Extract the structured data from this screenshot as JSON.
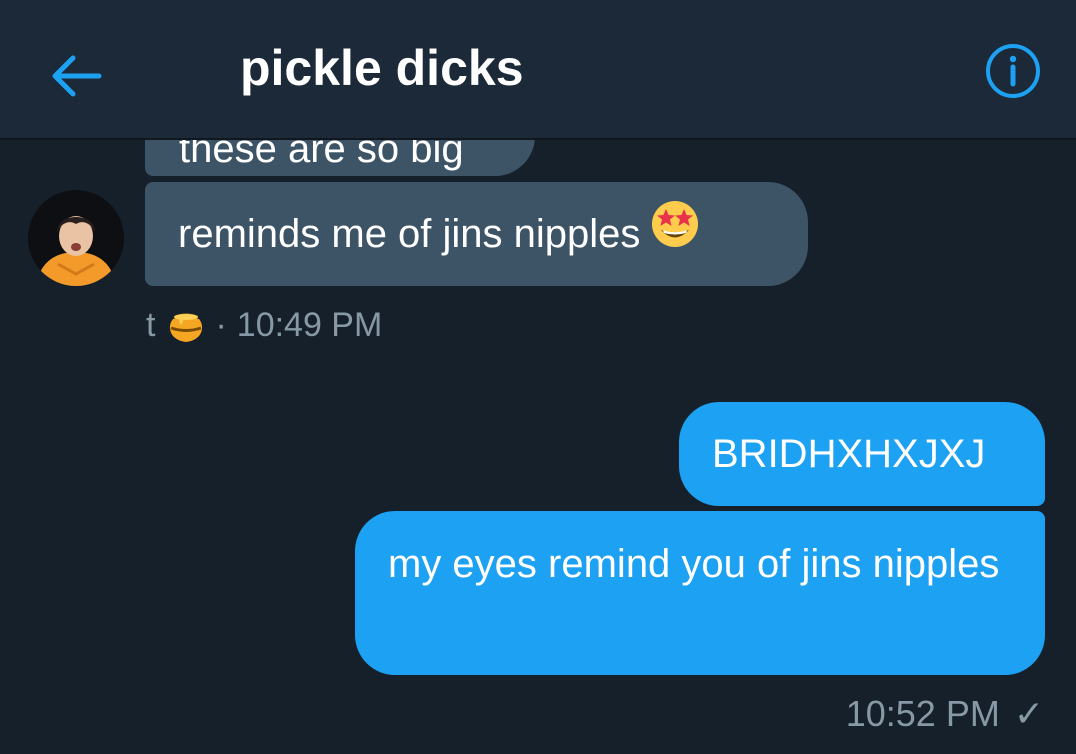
{
  "header": {
    "title": "pickle dicks",
    "back_icon": "arrow-left-icon",
    "info_icon": "info-circle-icon",
    "accent": "#1da1f2"
  },
  "messages": {
    "partial_text": "these are so big",
    "incoming": {
      "text": "reminds me of jins nipples",
      "emoji": "star-struck-emoji",
      "sender": "t",
      "sender_icon": "honey-pot-icon",
      "separator": "·",
      "time": "10:49 PM"
    },
    "outgoing": [
      {
        "text": "BRIDHXHXJXJ"
      },
      {
        "text": "my eyes remind you of jins nipples"
      }
    ],
    "outgoing_time": "10:52 PM",
    "outgoing_status": "✓"
  },
  "colors": {
    "background": "#15202b",
    "header_bg": "#1c2938",
    "incoming_bubble": "#3d5466",
    "outgoing_bubble": "#1da1f2",
    "meta_text": "#8899a6"
  }
}
